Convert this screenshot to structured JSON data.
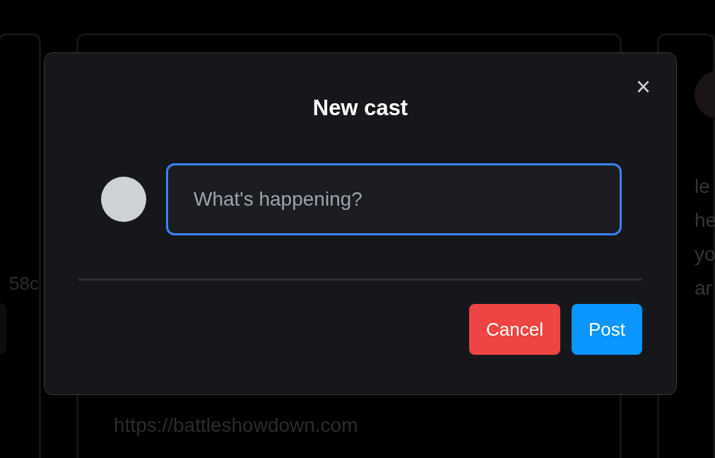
{
  "background": {
    "left_card": {
      "text": "58c"
    },
    "center_card": {
      "link": "https://battleshowdown.com"
    },
    "right_card": {
      "lines": [
        "le",
        "he",
        "yo",
        "ar"
      ]
    }
  },
  "dialog": {
    "title": "New cast",
    "close": "×",
    "input": {
      "placeholder": "What's happening?"
    },
    "buttons": [
      {
        "label": "Cancel",
        "kind": "cancel"
      },
      {
        "label": "Post",
        "kind": "primary"
      }
    ]
  }
}
